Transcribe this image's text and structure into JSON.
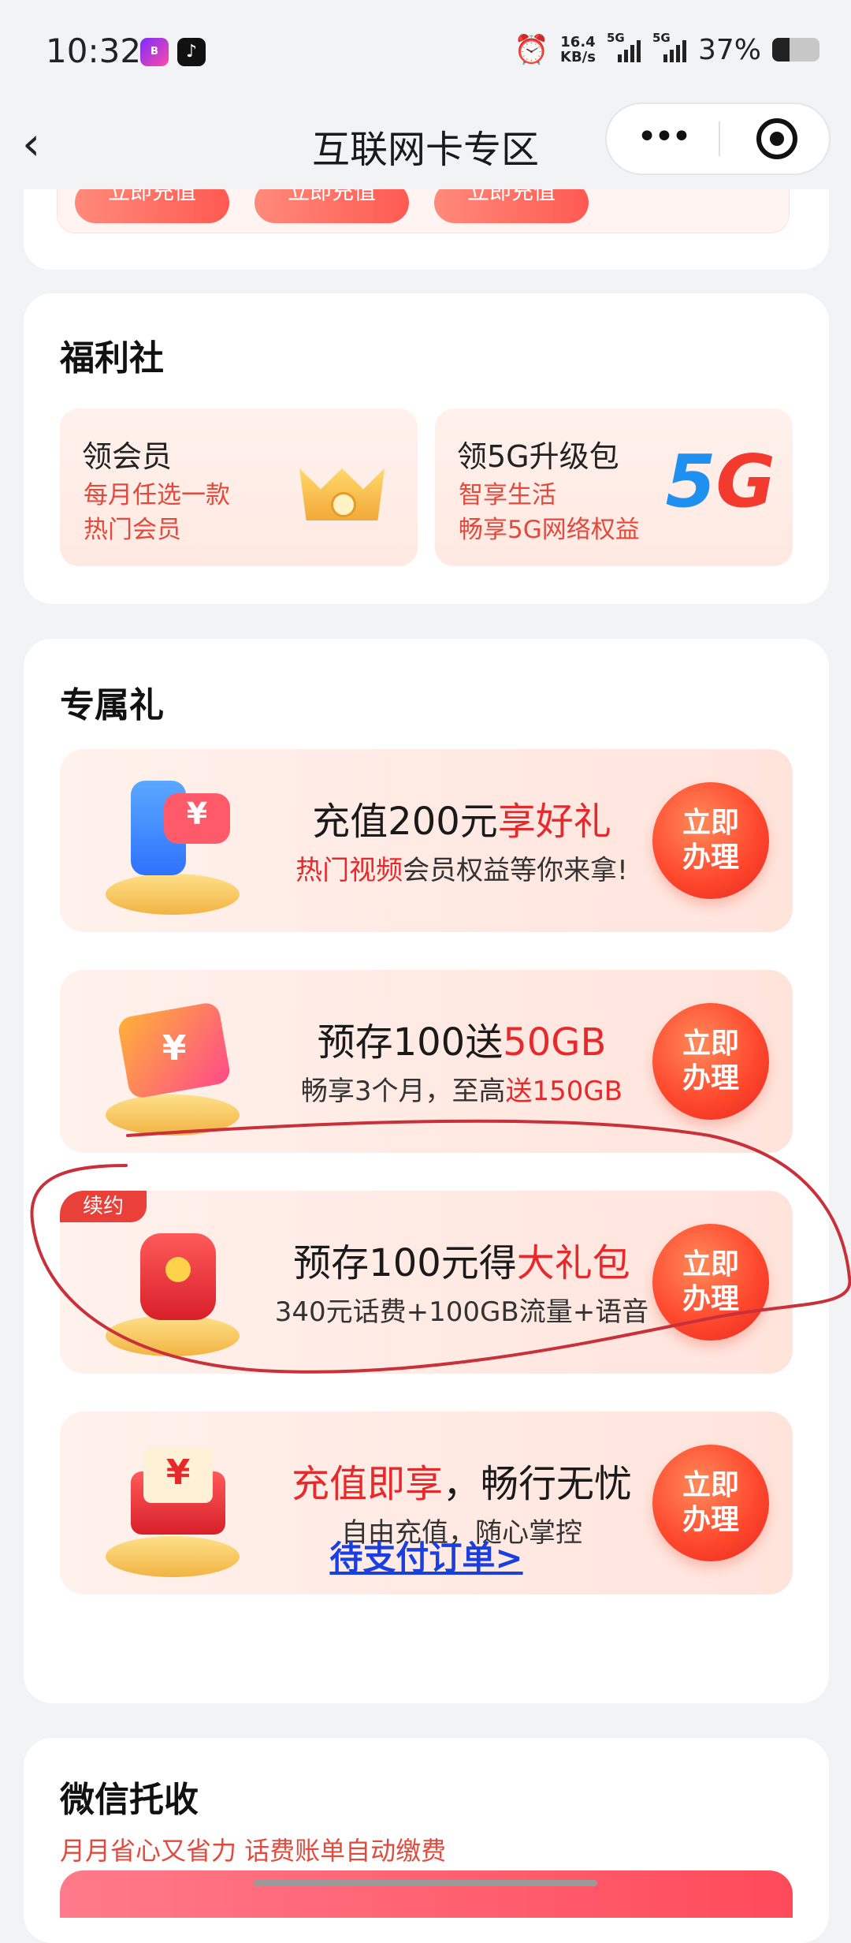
{
  "status_bar": {
    "time": "10:32",
    "app_icons": [
      "bank-app-icon",
      "tiktok-icon"
    ],
    "network_speed_value": "16.4",
    "network_speed_unit": "KB/s",
    "signal1_label": "5G",
    "signal2_label": "5G",
    "battery": "37%",
    "battery_level": 0.37
  },
  "nav": {
    "title": "互联网卡专区",
    "back_icon": "back-chevron-icon",
    "more_icon": "more-dots-icon",
    "close_icon": "target-icon"
  },
  "top_section": {
    "buttons": [
      "立即充值",
      "立即充值",
      "立即充值"
    ]
  },
  "welfare": {
    "title": "福利社",
    "items": [
      {
        "title": "领会员",
        "subtitle": "每月任选一款\n热门会员",
        "icon": "crown-icon"
      },
      {
        "title": "领5G升级包",
        "subtitle": "智享生活\n畅享5G网络权益",
        "icon": "5g-logo-icon"
      }
    ]
  },
  "exclusive": {
    "title": "专属礼",
    "offers": [
      {
        "title_a": "充值200元",
        "title_b": "享好礼",
        "title_c": "",
        "sub_a": "热门视频",
        "sub_b": "会员权益等你来拿!",
        "button": "立即\n办理",
        "icon": "phone-yuan-icon"
      },
      {
        "title_a": "预存100送",
        "title_b": "50GB",
        "title_c": "",
        "sub_a": "畅享3个月，至高",
        "sub_b": "送150GB",
        "button": "立即\n办理",
        "icon": "ticket-icon"
      },
      {
        "tag": "续约",
        "title_a": "预存100元得",
        "title_b": "大礼包",
        "title_c": "",
        "sub_a": "340元话费+100GB流量+语音",
        "sub_b": "",
        "button": "立即\n办理",
        "icon": "red-envelope-icon"
      },
      {
        "title_a": "",
        "title_b": "充值即享",
        "title_c": "，畅行无忧",
        "sub_a": "自由充值，随心掌控",
        "sub_b": "",
        "button": "立即\n办理",
        "icon": "yuan-envelope-icon"
      }
    ],
    "pending_link": "待支付订单>"
  },
  "wechat": {
    "title": "微信托收",
    "subtitle": "月月省心又省力 话费账单自动缴费"
  },
  "colors": {
    "accent_red": "#e8292b",
    "link_blue": "#1a3fe0",
    "annotation_red": "#c8303a"
  }
}
